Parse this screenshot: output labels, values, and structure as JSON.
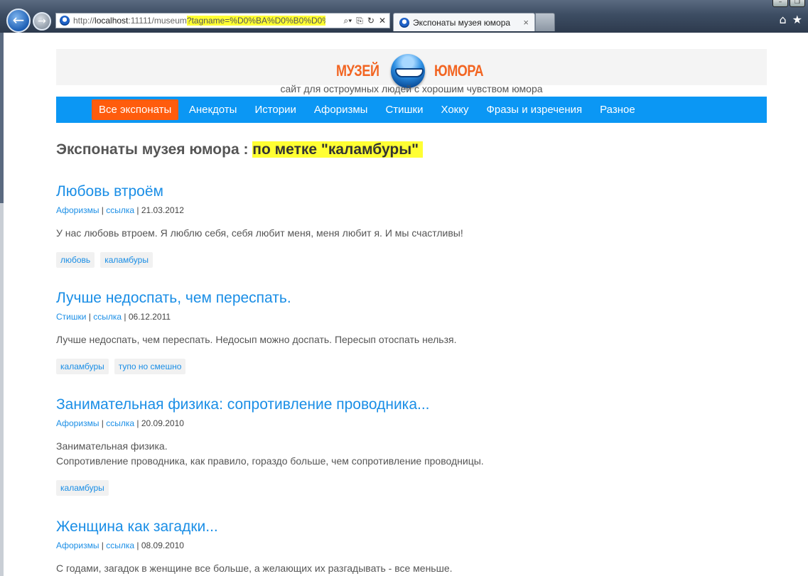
{
  "browser": {
    "url_host_prefix": "http://",
    "url_host": "localhost",
    "url_path": ":11111/museum",
    "url_query": "?tagname=%D0%BA%D0%B0%D0%",
    "tab_title": "Экспонаты музея юмора",
    "tab_close": "×",
    "addr_icons": [
      "⌕▾",
      "⎘",
      "↻",
      "✕"
    ],
    "window_buttons": [
      "–",
      "❐"
    ],
    "right_icons": [
      "⌂",
      "★"
    ]
  },
  "site": {
    "logo_left": "МУЗЕЙ",
    "logo_right": "ЮМОРА",
    "tagline": "сайт для остроумных людей с хорошим чувством юмора",
    "nav": [
      {
        "label": "Все экспонаты",
        "active": true
      },
      {
        "label": "Анекдоты"
      },
      {
        "label": "Истории"
      },
      {
        "label": "Афоризмы"
      },
      {
        "label": "Стишки"
      },
      {
        "label": "Хокку"
      },
      {
        "label": "Фразы и изречения"
      },
      {
        "label": "Разное"
      }
    ]
  },
  "page": {
    "title_prefix": "Экспонаты музея юмора : ",
    "title_highlight": "по метке \"каламбуры\""
  },
  "posts": [
    {
      "title": "Любовь втроём",
      "category": "Афоризмы",
      "link": "ссылка",
      "date": "21.03.2012",
      "body": [
        "У нас любовь втроем. Я люблю себя, себя любит меня, меня любит я. И мы счастливы!"
      ],
      "tags": [
        "любовь",
        "каламбуры"
      ]
    },
    {
      "title": "Лучше недоспать, чем переспать.",
      "category": "Стишки",
      "link": "ссылка",
      "date": "06.12.2011",
      "body": [
        "Лучше недоспать, чем переспать. Недосып можно доспать. Пересып отоспать нельзя."
      ],
      "tags": [
        "каламбуры",
        "тупо но смешно"
      ]
    },
    {
      "title": "Занимательная физика: сопротивление проводника...",
      "category": "Афоризмы",
      "link": "ссылка",
      "date": "20.09.2010",
      "body": [
        "Занимательная физика.",
        "Сопротивление проводника, как правило, гораздо больше, чем сопротивление проводницы."
      ],
      "tags": [
        "каламбуры"
      ]
    },
    {
      "title": "Женщина как загадки...",
      "category": "Афоризмы",
      "link": "ссылка",
      "date": "08.09.2010",
      "body": [
        "С годами, загадок в женщине все больше, а желающих их разгадывать - все меньше."
      ],
      "tags": []
    }
  ]
}
